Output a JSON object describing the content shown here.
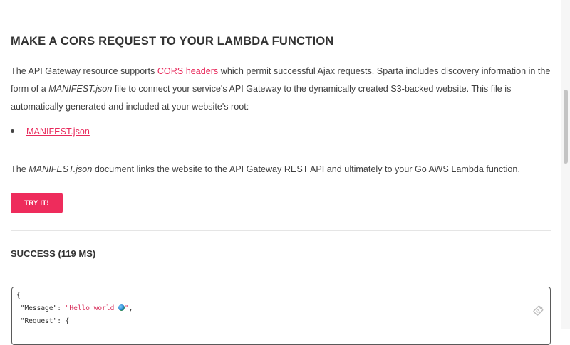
{
  "section": {
    "heading": "MAKE A CORS REQUEST TO YOUR LAMBDA FUNCTION",
    "intro_part1": "The API Gateway resource supports ",
    "intro_link": "CORS headers",
    "intro_part2": " which permit successful Ajax requests. Sparta includes discovery information in the form of a ",
    "intro_em": "MANIFEST.json",
    "intro_part3": " file to connect your service's API Gateway to the dynamically created S3-backed website. This file is automatically generated and included at your website's root:",
    "manifest_link": "MANIFEST.json",
    "outro_em": "MANIFEST.json",
    "outro_rest": " document links the website to the API Gateway REST API and ultimately to your Go AWS Lambda function.",
    "try_button": "TRY IT!"
  },
  "result": {
    "heading": "SUCCESS (119 MS)",
    "code": {
      "line1": "{",
      "line2_key": "\"Message\"",
      "line2_sep": ": ",
      "line2_value": "\"Hello world ",
      "line2_value_end": "\"",
      "line2_comma": ",",
      "line3_key": "\"Request\"",
      "line3_rest": ": {"
    }
  },
  "colors": {
    "accent": "#ee2c5c",
    "link": "#e8295b",
    "text": "#3f3f3f"
  },
  "icons": {
    "globe": "globe-emoji-icon",
    "copy": "clipboard-copy-icon"
  }
}
